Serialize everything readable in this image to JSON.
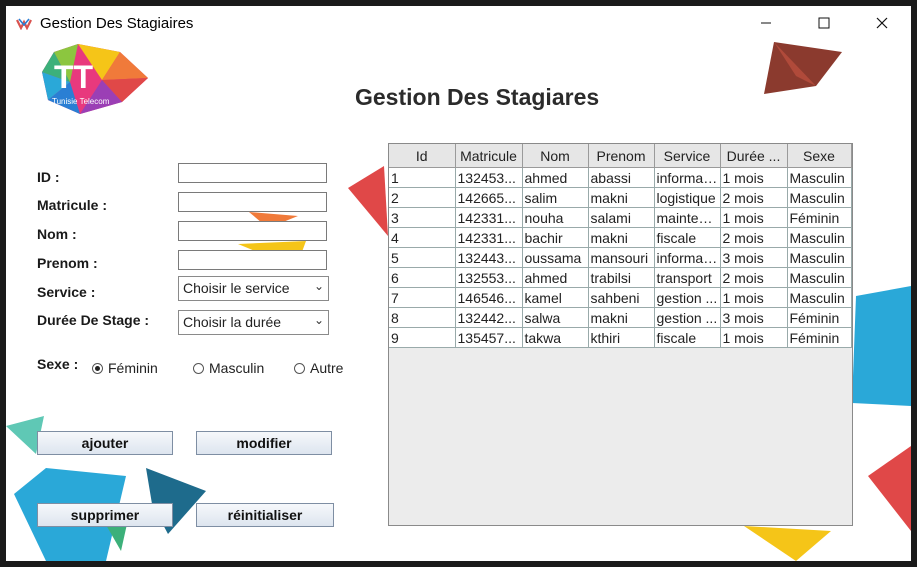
{
  "window": {
    "title": "Gestion Des Stagiaires",
    "controls": [
      "minimize-icon",
      "maximize-icon",
      "close-icon"
    ]
  },
  "logo": {
    "text": "TT",
    "subtext": "Tunisie Telecom"
  },
  "page_title": "Gestion Des Stagiares",
  "form": {
    "id_label": "ID :",
    "matricule_label": "Matricule :",
    "nom_label": "Nom :",
    "prenom_label": "Prenom :",
    "service_label": "Service :",
    "duree_label": "Durée De Stage :",
    "sexe_label": "Sexe :",
    "id_value": "",
    "matricule_value": "",
    "nom_value": "",
    "prenom_value": "",
    "service_selected": "Choisir le service",
    "duree_selected": "Choisir la durée",
    "sexe_options": [
      "Féminin",
      "Masculin",
      "Autre"
    ],
    "sexe_selected": "Féminin"
  },
  "buttons": {
    "ajouter": "ajouter",
    "modifier": "modifier",
    "supprimer": "supprimer",
    "reinitialiser": "réinitialiser"
  },
  "table": {
    "columns": [
      "Id",
      "Matricule",
      "Nom",
      "Prenom",
      "Service",
      "Durée ...",
      "Sexe"
    ],
    "rows": [
      [
        "1",
        "132453...",
        "ahmed",
        "abassi",
        "informat...",
        "1 mois",
        "Masculin"
      ],
      [
        "2",
        "142665...",
        "salim",
        "makni",
        "logistique",
        "2 mois",
        "Masculin"
      ],
      [
        "3",
        "142331...",
        "nouha",
        "salami",
        "mainten...",
        "1 mois",
        "Féminin"
      ],
      [
        "4",
        "142331...",
        "bachir",
        "makni",
        "fiscale",
        "2 mois",
        "Masculin"
      ],
      [
        "5",
        "132443...",
        "oussama",
        "mansouri",
        "informat...",
        "3 mois",
        "Masculin"
      ],
      [
        "6",
        "132553...",
        "ahmed",
        "trabilsi",
        "transport",
        "2 mois",
        "Masculin"
      ],
      [
        "7",
        "146546...",
        "kamel",
        "sahbeni",
        "gestion ...",
        "1 mois",
        "Masculin"
      ],
      [
        "8",
        "132442...",
        "salwa",
        "makni",
        "gestion ...",
        "3 mois",
        "Féminin"
      ],
      [
        "9",
        "135457...",
        "takwa",
        "kthiri",
        "fiscale",
        "1 mois",
        "Féminin"
      ]
    ]
  },
  "colors": {
    "accent_blue": "#2aa8d8",
    "accent_red": "#e04848",
    "accent_yellow": "#f5c518",
    "accent_brown": "#8b3a2e"
  }
}
